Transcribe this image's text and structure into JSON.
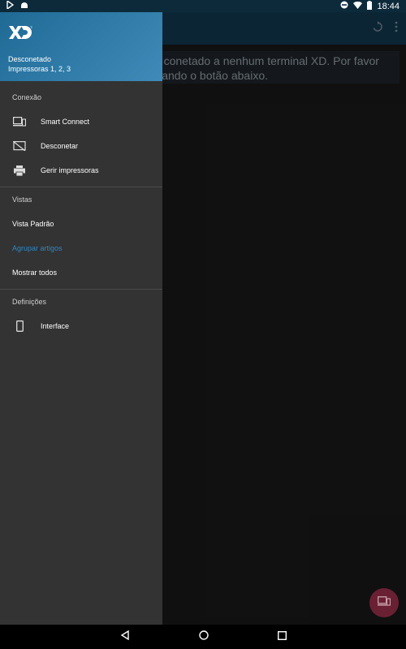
{
  "status_bar": {
    "time": "18:44",
    "icons": [
      "play-store-icon",
      "android-icon",
      "do-not-disturb-icon",
      "wifi-icon",
      "battery-icon"
    ]
  },
  "main": {
    "message_line1": "stá conetado a nenhum terminal XD. Por favor",
    "message_line2": "tilizando o botão abaixo.",
    "toolbar_icons": [
      "sync-icon",
      "overflow-menu-icon"
    ],
    "fab_icon": "connect-device-icon"
  },
  "drawer": {
    "logo": "XD",
    "status": "Desconetado",
    "printers": "Impressoras 1, 2, 3",
    "sections": [
      {
        "label": "Conexão",
        "items": [
          {
            "label": "Smart Connect",
            "icon": "devices-icon"
          },
          {
            "label": "Desconetar",
            "icon": "cast-off-icon"
          },
          {
            "label": "Gerir impressoras",
            "icon": "printer-icon"
          }
        ]
      },
      {
        "label": "Vistas",
        "items": [
          {
            "label": "Vista Padrão"
          },
          {
            "label": "Agrupar artigos",
            "selected": true
          },
          {
            "label": "Mostrar todos"
          }
        ]
      },
      {
        "label": "Definições",
        "items": [
          {
            "label": "Interface",
            "icon": "phone-icon"
          }
        ]
      }
    ]
  },
  "colors": {
    "drawer_header": "#2f7aa8",
    "drawer_bg": "#333333",
    "accent": "#2a87c6",
    "fab": "#6a2033",
    "toolbar": "#123a52"
  }
}
